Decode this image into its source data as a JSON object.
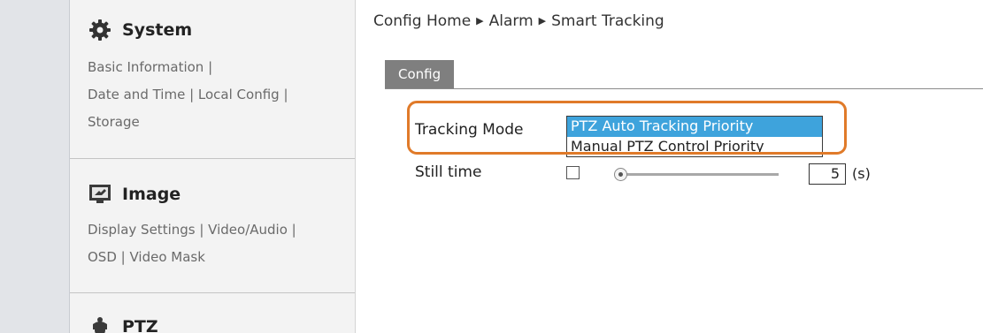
{
  "sidebar": {
    "sections": [
      {
        "title": "System",
        "icon": "gear-icon",
        "links": [
          "Basic Information |",
          "Date and Time | Local Config |",
          "Storage"
        ]
      },
      {
        "title": "Image",
        "icon": "image-settings-icon",
        "links": [
          "Display Settings | Video/Audio |",
          "OSD | Video Mask"
        ]
      },
      {
        "title": "PTZ",
        "icon": "ptz-camera-icon",
        "links": []
      }
    ]
  },
  "breadcrumb": {
    "items": [
      "Config Home",
      "Alarm",
      "Smart Tracking"
    ],
    "separator": "▶"
  },
  "tabs": [
    {
      "label": "Config",
      "active": true
    }
  ],
  "form": {
    "tracking_mode": {
      "label": "Tracking Mode",
      "options": [
        "PTZ Auto Tracking Priority",
        "Manual PTZ Control Priority"
      ],
      "selected": "PTZ Auto Tracking Priority"
    },
    "still_time": {
      "label": "Still time",
      "checked": false,
      "value": "5",
      "unit": "(s)",
      "slider_fraction": 0.05
    }
  },
  "colors": {
    "highlight": "#e07a29",
    "selected_option": "#3ea3dc",
    "tab_background": "#7f7f7f",
    "sidebar_background": "#f3f3f3"
  }
}
